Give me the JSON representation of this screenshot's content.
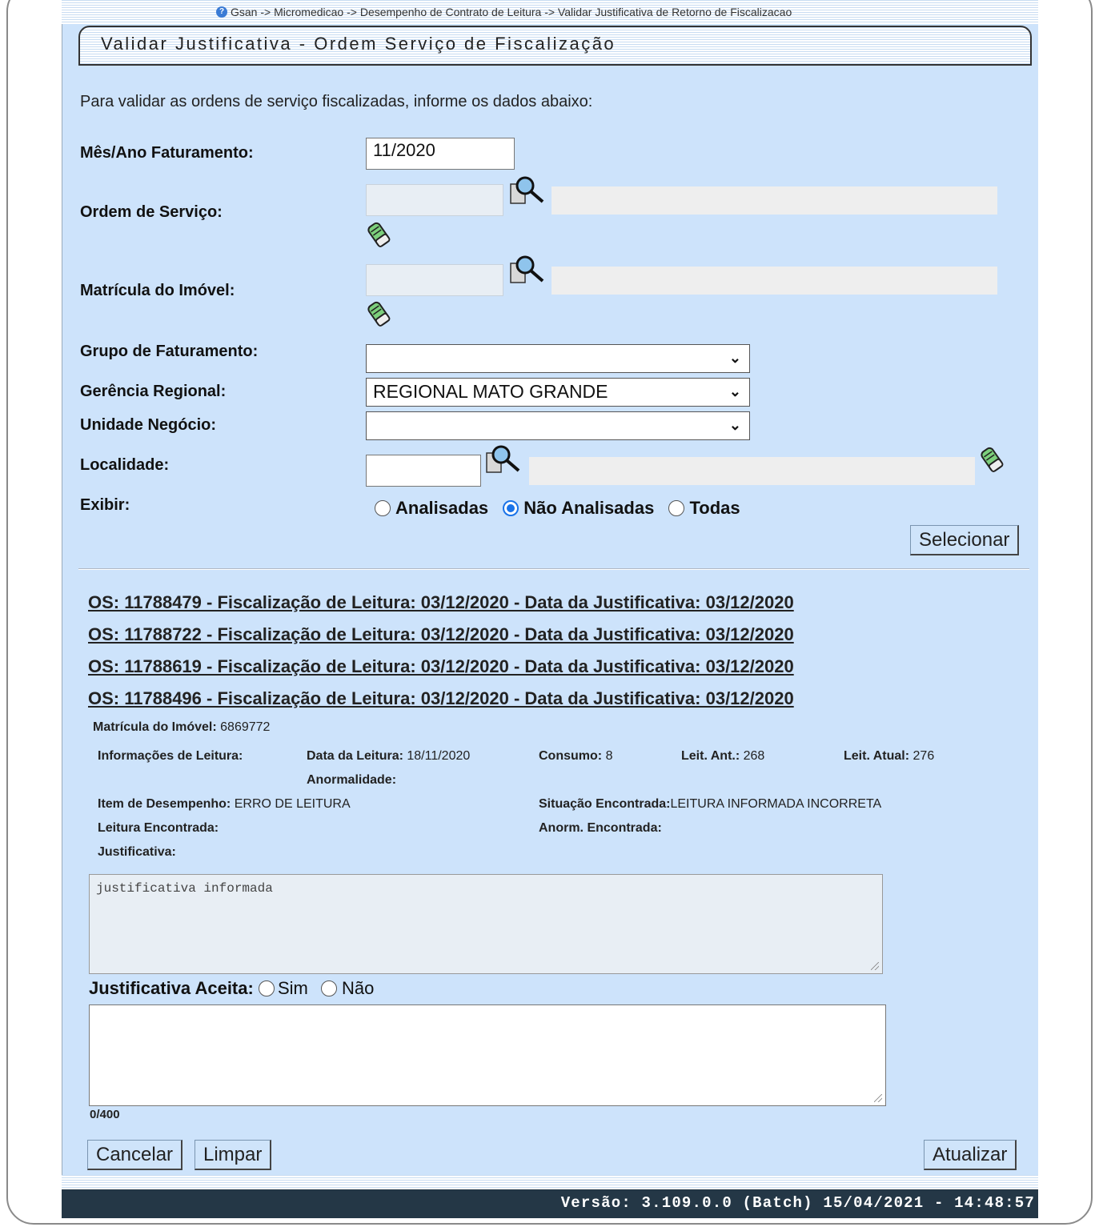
{
  "breadcrumb": "Gsan -> Micromedicao -> Desempenho de Contrato de Leitura -> Validar Justificativa de Retorno de Fiscalizacao",
  "title": "Validar Justificativa - Ordem Serviço de Fiscalização",
  "intro": "Para validar as ordens de serviço fiscalizadas, informe os dados abaixo:",
  "form": {
    "mes_ano_label": "Mês/Ano Faturamento:",
    "mes_ano_value": "11/2020",
    "ordem_label": "Ordem de Serviço:",
    "matricula_label": "Matrícula do Imóvel:",
    "grupo_label": "Grupo de Faturamento:",
    "grupo_value": "",
    "gerencia_label": "Gerência Regional:",
    "gerencia_value": "REGIONAL MATO GRANDE",
    "unidade_label": "Unidade Negócio:",
    "unidade_value": "",
    "localidade_label": "Localidade:",
    "exibir_label": "Exibir:",
    "exibir_options": [
      "Analisadas",
      "Não Analisadas",
      "Todas"
    ],
    "exibir_selected": "Não Analisadas",
    "selecionar_label": "Selecionar"
  },
  "os_list": [
    "OS: 11788479 - Fiscalização de Leitura: 03/12/2020 - Data da Justificativa: 03/12/2020",
    "OS: 11788722 - Fiscalização de Leitura: 03/12/2020 - Data da Justificativa: 03/12/2020",
    "OS: 11788619 - Fiscalização de Leitura: 03/12/2020 - Data da Justificativa: 03/12/2020",
    "OS: 11788496 - Fiscalização de Leitura: 03/12/2020 - Data da Justificativa: 03/12/2020"
  ],
  "detail": {
    "matricula_label": "Matrícula do Imóvel:",
    "matricula_value": "6869772",
    "info_leitura_label": "Informações de Leitura:",
    "data_leitura_label": "Data da Leitura:",
    "data_leitura_value": "18/11/2020",
    "consumo_label": "Consumo:",
    "consumo_value": "8",
    "leit_ant_label": "Leit. Ant.:",
    "leit_ant_value": "268",
    "leit_atual_label": "Leit. Atual:",
    "leit_atual_value": "276",
    "anormalidade_label": "Anormalidade:",
    "item_desempenho_label": "Item de Desempenho:",
    "item_desempenho_value": "ERRO DE LEITURA",
    "situacao_label": "Situação Encontrada:",
    "situacao_value": "LEITURA INFORMADA INCORRETA",
    "leitura_encontrada_label": "Leitura Encontrada:",
    "anorm_encontrada_label": "Anorm. Encontrada:",
    "justificativa_label": "Justificativa:",
    "justificativa_text": "justificativa informada",
    "aceita_label": "Justificativa Aceita:",
    "aceita_options": [
      "Sim",
      "Não"
    ],
    "counter": "0/400"
  },
  "buttons": {
    "cancelar": "Cancelar",
    "limpar": "Limpar",
    "atualizar": "Atualizar"
  },
  "footer": "Versão: 3.109.0.0 (Batch) 15/04/2021 - 14:48:57",
  "icons": {
    "search": "magnifier-icon",
    "eraser": "eraser-icon",
    "help": "help-icon"
  }
}
